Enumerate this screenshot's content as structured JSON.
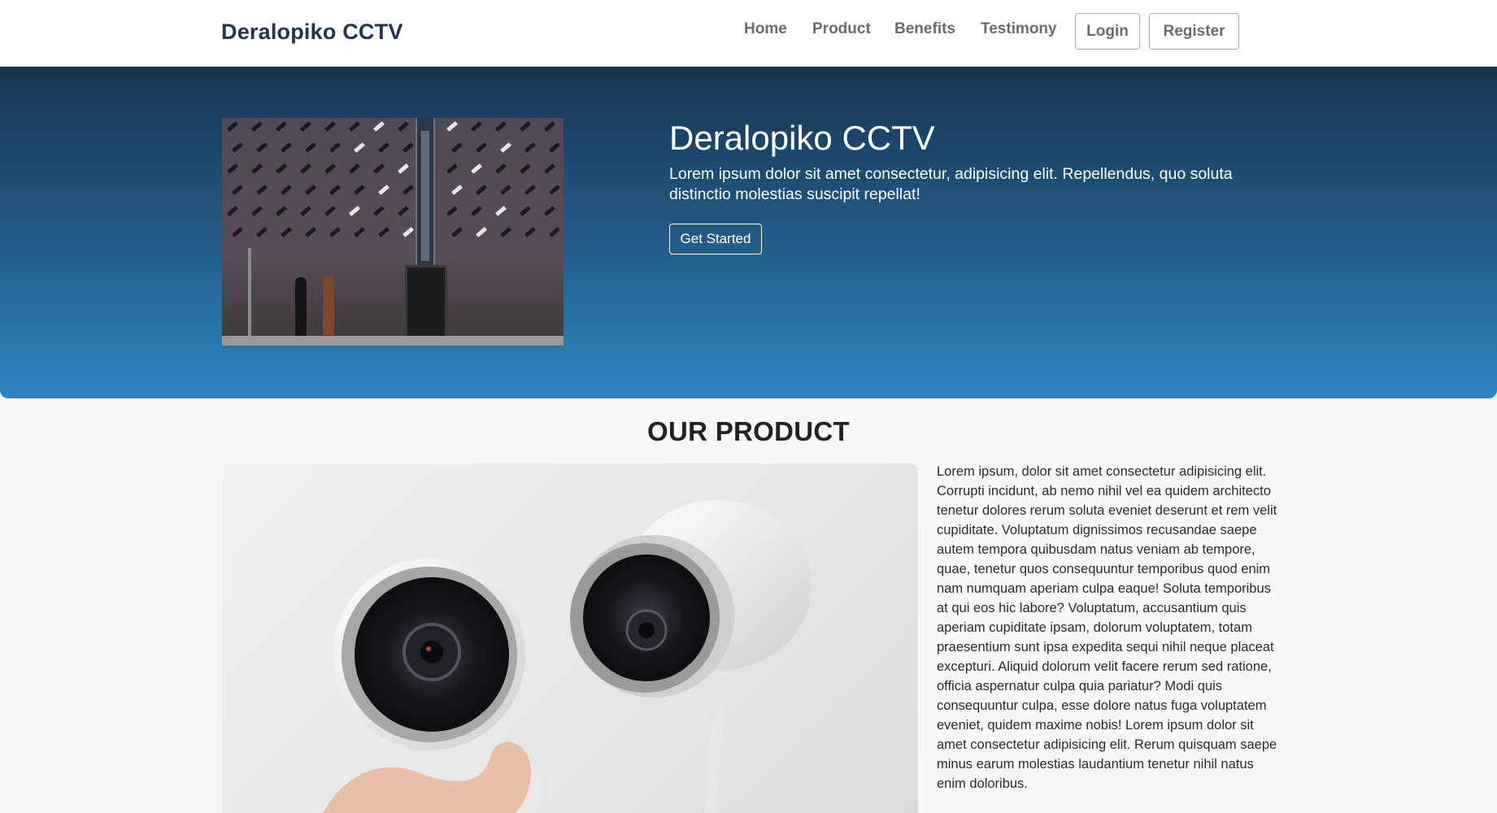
{
  "navbar": {
    "brand": "Deralopiko CCTV",
    "links": [
      "Home",
      "Product",
      "Benefits",
      "Testimony"
    ],
    "login_label": "Login",
    "register_label": "Register"
  },
  "hero": {
    "title": "Deralopiko CCTV",
    "text": "Lorem ipsum dolor sit amet consectetur, adipisicing elit. Repellendus, quo soluta distinctio molestias suscipit repellat!",
    "cta_label": "Get Started"
  },
  "product": {
    "title": "OUR PRODUCT",
    "text": "Lorem ipsum, dolor sit amet consectetur adipisicing elit. Corrupti incidunt, ab nemo nihil vel ea quidem architecto tenetur dolores rerum soluta eveniet deserunt et rem velit cupiditate. Voluptatum dignissimos recusandae saepe autem tempora quibusdam natus veniam ab tempore, quae, tenetur quos consequuntur temporibus quod enim nam numquam aperiam culpa eaque! Soluta temporibus at qui eos hic labore? Voluptatum, accusantium quis aperiam cupiditate ipsam, dolorum voluptatem, totam praesentium sunt ipsa expedita sequi nihil neque placeat excepturi. Aliquid dolorum velit facere rerum sed ratione, officia aspernatur culpa quia pariatur? Modi quis consequuntur culpa, esse dolore natus fuga voluptatem eveniet, quidem maxime nobis! Lorem ipsum dolor sit amet consectetur adipisicing elit. Rerum quisquam saepe minus earum molestias laudantium tenetur nihil natus enim doloribus."
  },
  "colors": {
    "brand": "#24344d",
    "hero_top": "#173451",
    "hero_bottom": "#2e86c1",
    "nav_text": "#6b6b6b"
  }
}
